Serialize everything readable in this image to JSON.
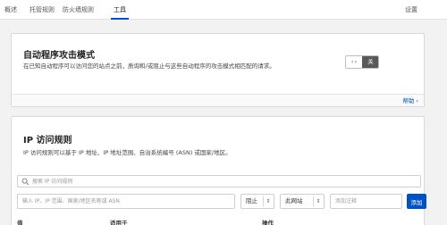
{
  "nav": {
    "tabs": [
      {
        "label": "概述"
      },
      {
        "label": "托管规则"
      },
      {
        "label": "防火墙规则"
      },
      {
        "label": "工具"
      }
    ],
    "active_tab": "工具",
    "settings_label": "设置"
  },
  "automated_attack": {
    "title": "自动程序攻击模式",
    "description": "在已知自动程序可以访问您的站点之前，质询和/或阻止与这些自动程序的攻击模式相匹配的请求。",
    "toggle": {
      "knob_label": "‹›",
      "state_label": "关",
      "enabled": false
    },
    "help_label": "帮助 ›"
  },
  "ip_access": {
    "title": "IP 访问规则",
    "description": "IP 访问规则可以基于 IP 地址、IP 地址范围、自治系统编号 (ASN) 或国家/地区。",
    "search": {
      "placeholder": "搜索 IP 访问规则",
      "value": ""
    },
    "form": {
      "value_placeholder": "输入 IP、IP 范围、国家/地区名称或 ASN",
      "action_selected": "阻止",
      "scope_selected": "此网站",
      "note_placeholder": "添加注释",
      "add_label": "添加"
    },
    "table": {
      "columns": [
        "值",
        "适用于",
        "操作"
      ]
    }
  },
  "colors": {
    "accent": "#0051c3",
    "toggle_off": "#595959"
  }
}
